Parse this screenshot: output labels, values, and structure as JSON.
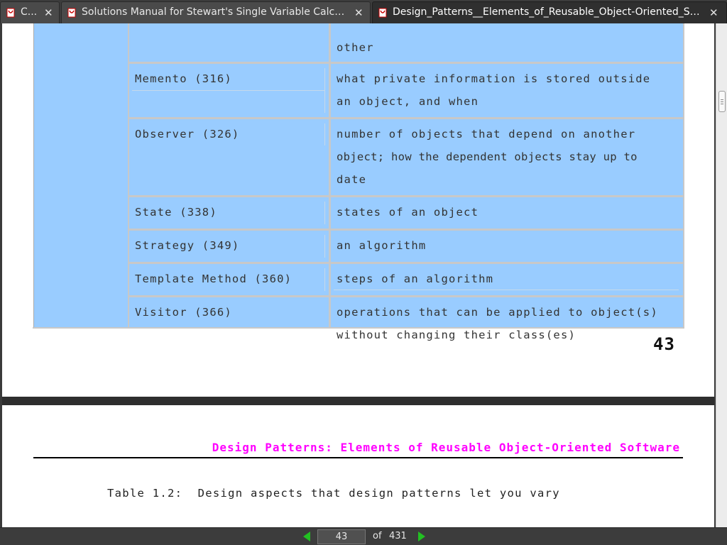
{
  "tabs": [
    {
      "label": "C...",
      "close": "✕",
      "active": false
    },
    {
      "label": "Solutions Manual for Stewart's Single Variable Calculu...",
      "close": "✕",
      "active": false
    },
    {
      "label": "Design_Patterns__Elements_of_Reusable_Object-Oriented_Sof...",
      "close": "✕",
      "active": true
    }
  ],
  "document": {
    "upper_page": {
      "table_rows": [
        {
          "pattern": "",
          "aspect_lines": [
            "other"
          ]
        },
        {
          "pattern": "Memento (316)",
          "aspect_lines": [
            "what private information is stored outside",
            "an object, and when"
          ]
        },
        {
          "pattern": "Observer (326)",
          "aspect_lines": [
            "number of objects that depend on another",
            "object; how the dependent objects stay up to",
            "date"
          ]
        },
        {
          "pattern": "State (338)",
          "aspect_lines": [
            "states of an object"
          ]
        },
        {
          "pattern": "Strategy (349)",
          "aspect_lines": [
            "an algorithm"
          ]
        },
        {
          "pattern": "Template Method (360)",
          "aspect_lines": [
            "steps of an algorithm"
          ]
        },
        {
          "pattern": "Visitor (366)",
          "aspect_lines": [
            "operations that can be applied to object(s)",
            "without changing their class(es)"
          ]
        }
      ],
      "page_number": "43"
    },
    "lower_page": {
      "running_header": "Design Patterns: Elements of Reusable Object-Oriented Software",
      "caption": "Table 1.2:  Design aspects that design patterns let you vary"
    }
  },
  "navigation": {
    "current_page": "43",
    "of_label": "of",
    "total_pages": "431"
  },
  "colors": {
    "table_fill": "#99ccff",
    "header_magenta": "#ff00ff",
    "nav_arrow_green": "#22c022"
  }
}
